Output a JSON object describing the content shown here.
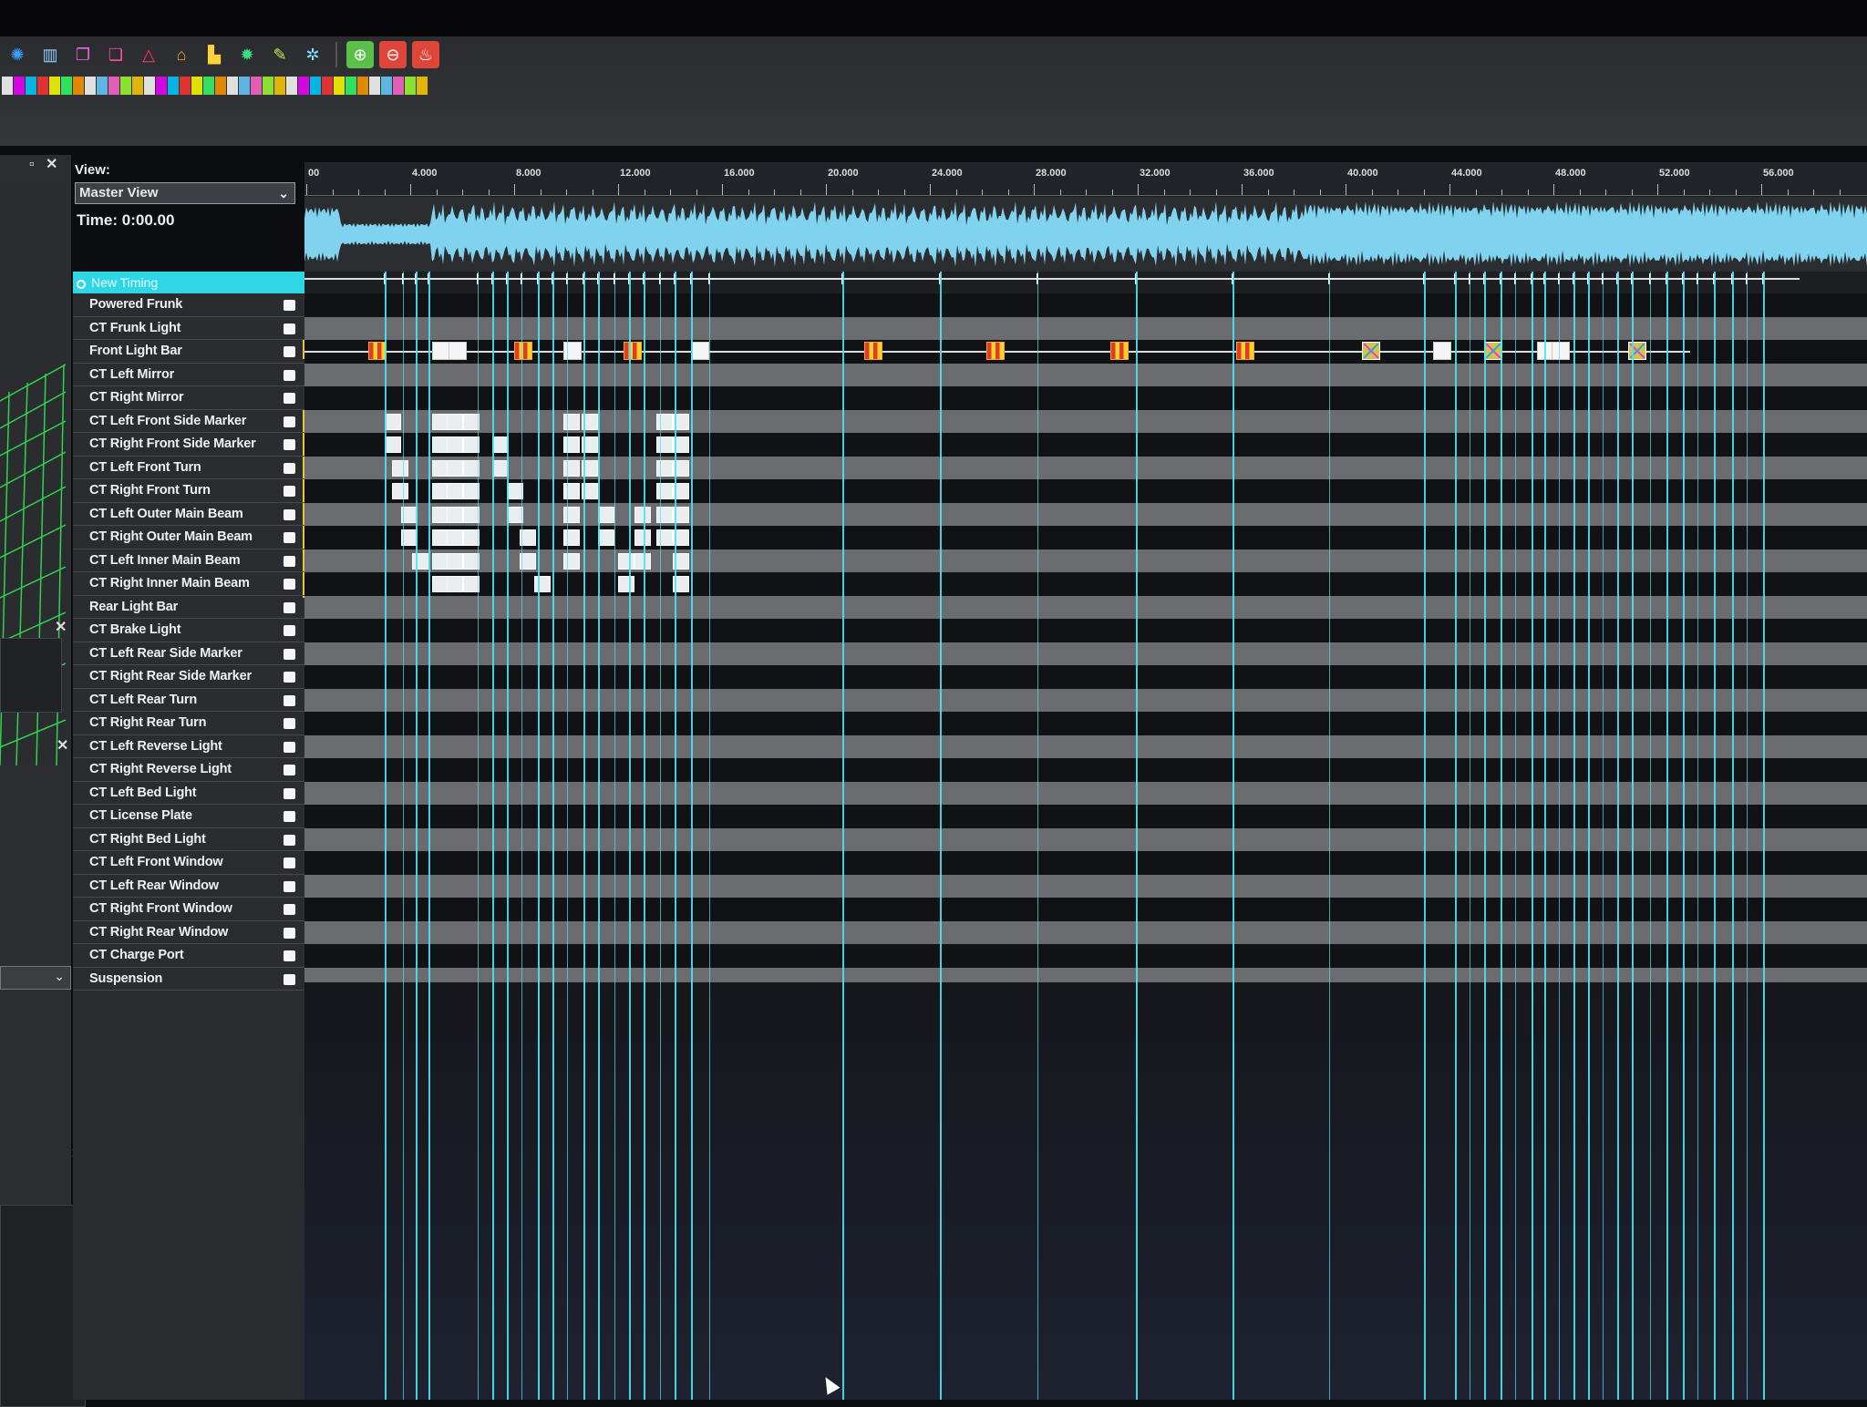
{
  "toolbar": {
    "row1_icons": [
      "gear-blue-icon",
      "bars-icon",
      "copy-icon",
      "paste-icon",
      "triangle-icon",
      "home-icon",
      "pipe-icon",
      "sun-icon",
      "brush-icon",
      "gear-icon",
      "zoom-in-icon",
      "zoom-out-icon",
      "fire-icon"
    ],
    "row2_count": 36
  },
  "view": {
    "label": "View:",
    "selected": "Master View",
    "time": "Time: 0:00.00"
  },
  "timing": {
    "label": "New Timing"
  },
  "tracks": [
    "Powered Frunk",
    "CT Frunk Light",
    "Front Light Bar",
    "CT Left Mirror",
    "CT Right Mirror",
    "CT Left Front Side Marker",
    "CT Right Front Side Marker",
    "CT Left Front Turn",
    "CT Right Front Turn",
    "CT Left Outer Main Beam",
    "CT Right Outer Main Beam",
    "CT Left Inner Main Beam",
    "CT Right Inner Main Beam",
    "Rear Light Bar",
    "CT Brake Light",
    "CT Left Rear Side Marker",
    "CT Right Rear Side Marker",
    "CT Left Rear Turn",
    "CT Right Rear Turn",
    "CT Left Reverse Light",
    "CT Right Reverse Light",
    "CT Left Bed Light",
    "CT License Plate",
    "CT Right Bed Light",
    "CT Left Front Window",
    "CT Left Rear Window",
    "CT Right Front Window",
    "CT Right Rear Window",
    "CT Charge Port",
    "Suspension"
  ],
  "ruler": {
    "labels": [
      "00",
      "4.000",
      "8.000",
      "12.000",
      "16.000",
      "20.000",
      "24.000",
      "28.000",
      "32.000",
      "36.000",
      "40.000",
      "44.000",
      "48.000",
      "52.000",
      "56.000"
    ]
  },
  "colors": {
    "accent": "#2ed6e6",
    "waveform": "#7fd3ee",
    "timing_line": "#4fe3ee"
  }
}
